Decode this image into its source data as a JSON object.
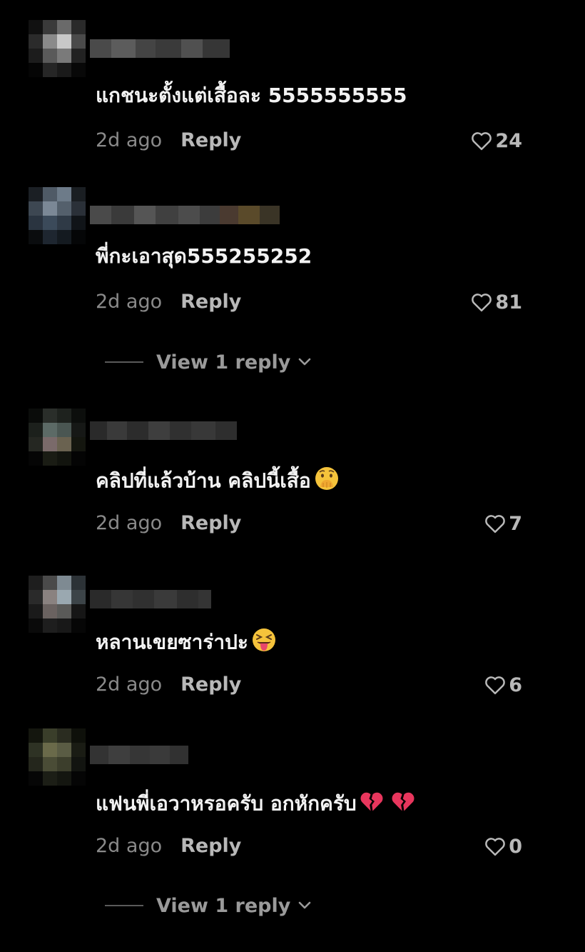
{
  "comments": [
    {
      "text": "แกชนะตั้งแต่เสื้อละ 5555555555",
      "time": "2d ago",
      "reply_label": "Reply",
      "likes": "24",
      "emojis": []
    },
    {
      "text": "พี่กะเอาสุด555255252",
      "time": "2d ago",
      "reply_label": "Reply",
      "likes": "81",
      "view_replies": "View 1 reply",
      "emojis": []
    },
    {
      "text": "คลิปที่แล้วบ้าน คลิปนี้เสื้อ",
      "time": "2d ago",
      "reply_label": "Reply",
      "likes": "7",
      "emojis": [
        "face-with-hand-over-mouth"
      ]
    },
    {
      "text": "หลานเขยซาร่าปะ",
      "time": "2d ago",
      "reply_label": "Reply",
      "likes": "6",
      "emojis": [
        "face-with-tongue"
      ]
    },
    {
      "text": "แฟนพี่เอวาหรอครับ อกหักครับ",
      "time": "2d ago",
      "reply_label": "Reply",
      "likes": "0",
      "view_replies": "View 1 reply",
      "emojis": [
        "broken-heart",
        "broken-heart"
      ]
    }
  ],
  "colors": {
    "background": "#000000",
    "comment_text": "#f2f2f2",
    "meta_time": "#8a8a8a",
    "meta_action": "#b8b8b8",
    "broken_heart": "#e8365d"
  }
}
